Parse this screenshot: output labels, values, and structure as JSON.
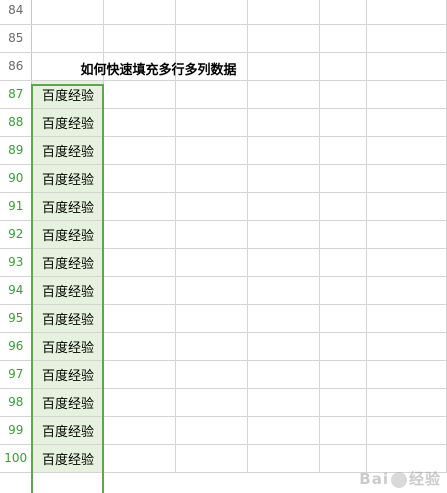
{
  "sheet": {
    "title": "如何快速填充多行多列数据",
    "top_rows": [
      "84",
      "85"
    ],
    "title_row": "86",
    "filled_rows": [
      {
        "row": "87",
        "value": "百度经验"
      },
      {
        "row": "88",
        "value": "百度经验"
      },
      {
        "row": "89",
        "value": "百度经验"
      },
      {
        "row": "90",
        "value": "百度经验"
      },
      {
        "row": "91",
        "value": "百度经验"
      },
      {
        "row": "92",
        "value": "百度经验"
      },
      {
        "row": "93",
        "value": "百度经验"
      },
      {
        "row": "94",
        "value": "百度经验"
      },
      {
        "row": "95",
        "value": "百度经验"
      },
      {
        "row": "96",
        "value": "百度经验"
      },
      {
        "row": "97",
        "value": "百度经验"
      },
      {
        "row": "98",
        "value": "百度经验"
      },
      {
        "row": "99",
        "value": "百度经验"
      },
      {
        "row": "100",
        "value": "百度经验"
      }
    ]
  },
  "watermark": {
    "text_left": "Bai",
    "text_right": "经验"
  },
  "colors": {
    "selection_border": "#5fa74f",
    "selection_fill": "#e6f2de",
    "selected_row_header": "#3c9a3c"
  }
}
